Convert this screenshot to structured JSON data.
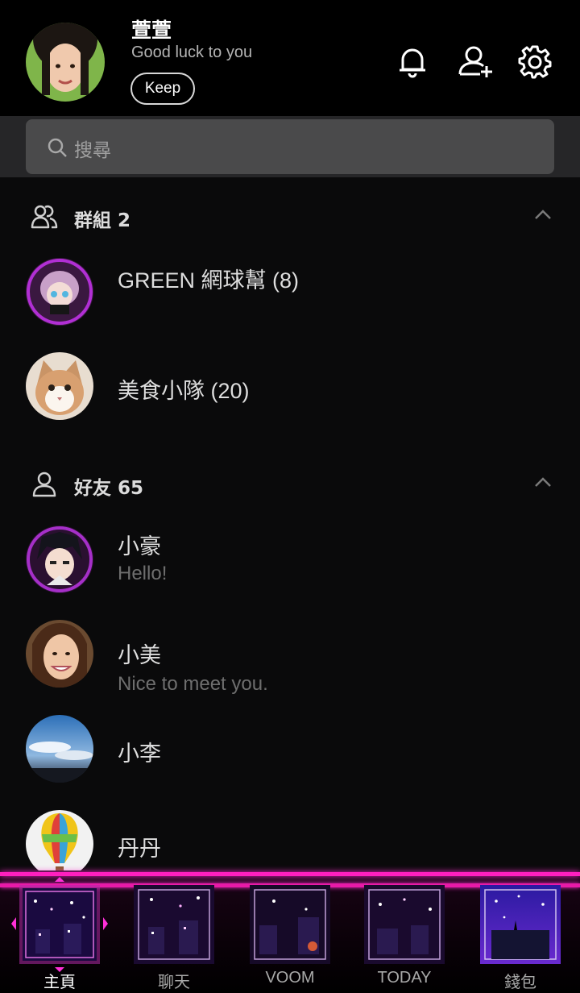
{
  "profile": {
    "name": "萱萱",
    "status": "Good luck to you",
    "keep_label": "Keep"
  },
  "header_icons": [
    "bell-icon",
    "add-friend-icon",
    "settings-gear-icon"
  ],
  "search": {
    "placeholder": "搜尋"
  },
  "groups": {
    "title": "群組 2",
    "items": [
      {
        "name": "GREEN 網球幫 (8)"
      },
      {
        "name": "美食小隊 (20)"
      }
    ]
  },
  "friends": {
    "title": "好友 65",
    "items": [
      {
        "name": "小豪",
        "message": "Hello!"
      },
      {
        "name": "小美",
        "message": "Nice to meet you."
      },
      {
        "name": "小李",
        "message": ""
      },
      {
        "name": "丹丹",
        "message": ""
      }
    ]
  },
  "tabs": [
    {
      "label": "主頁",
      "active": true
    },
    {
      "label": "聊天",
      "active": false
    },
    {
      "label": "VOOM",
      "active": false
    },
    {
      "label": "TODAY",
      "active": false
    },
    {
      "label": "錢包",
      "active": false
    }
  ],
  "colors": {
    "accent_neon": "#ff1fbf",
    "background": "#0a0a0b"
  }
}
